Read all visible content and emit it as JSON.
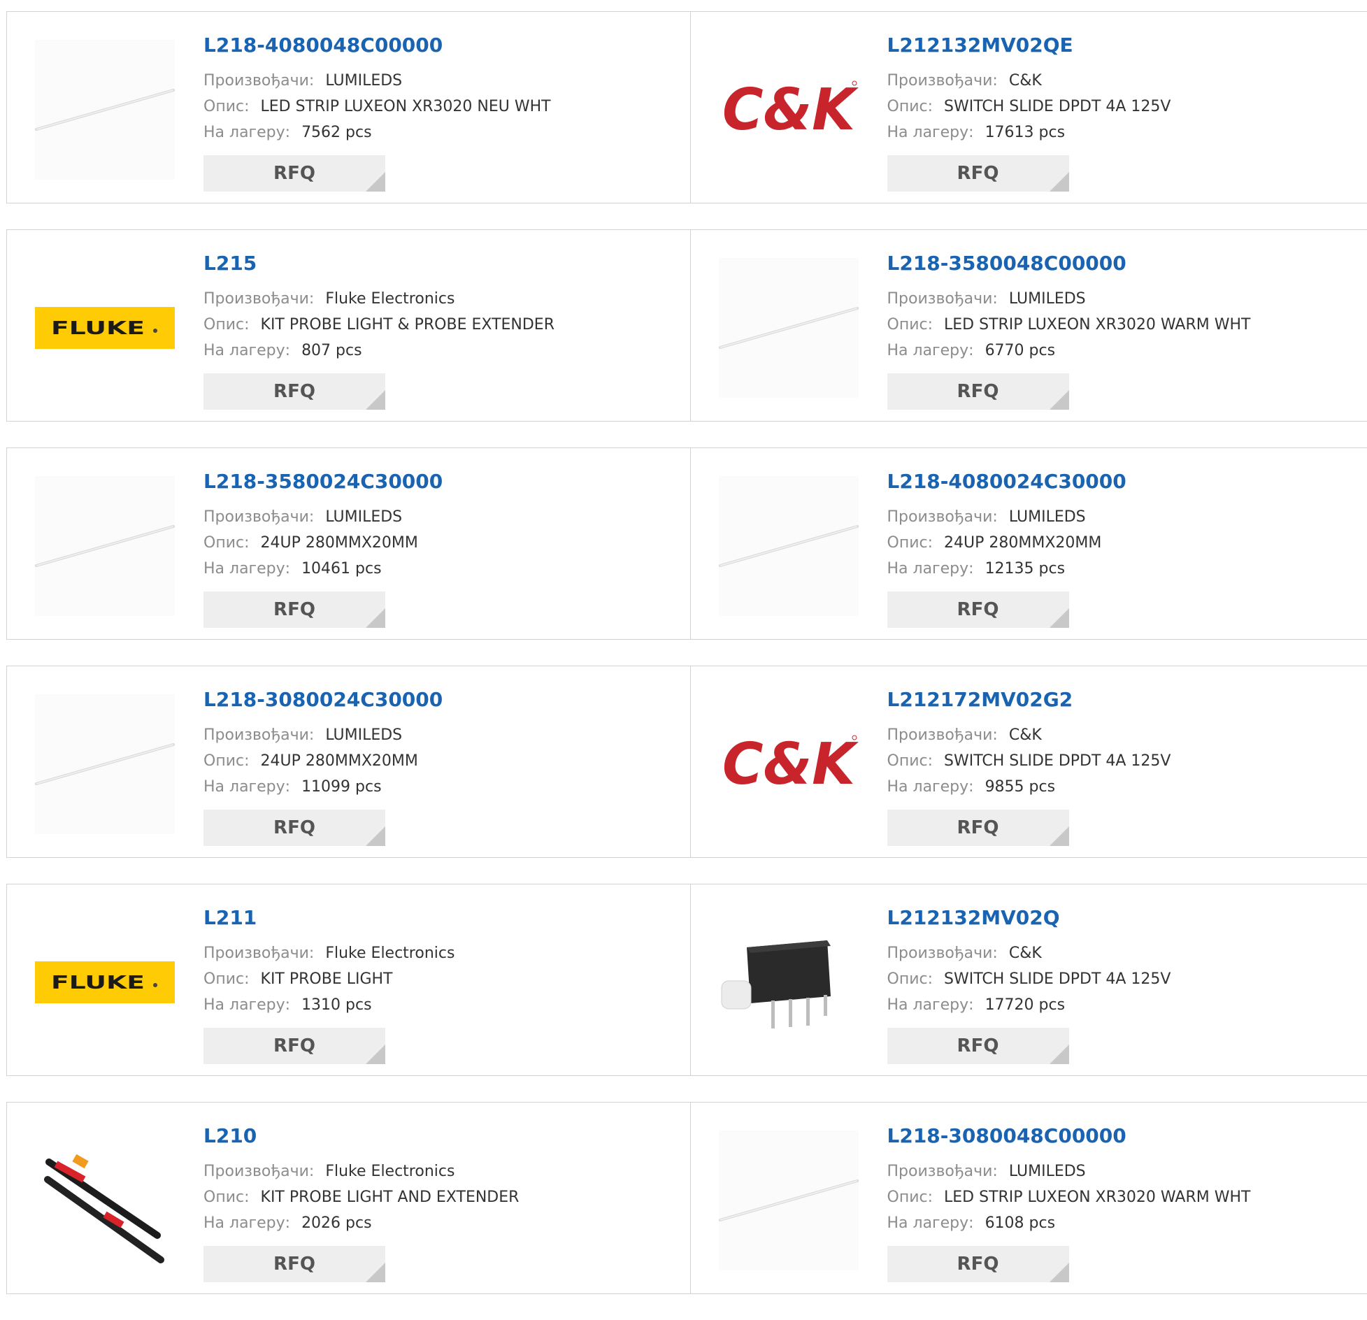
{
  "labels": {
    "manufacturer": "Произвођачи:",
    "description": "Опис:",
    "stock": "На лагеру:",
    "rfq": "RFQ"
  },
  "logos": {
    "ck_text": "C&K",
    "fluke_text": "FLUKE"
  },
  "colors": {
    "part_link": "#1a63b0",
    "ck_red": "#c8242c",
    "fluke_yellow": "#ffcb05"
  },
  "products": [
    {
      "pn": "L218-4080048C00000",
      "mfr": "LUMILEDS",
      "desc": "LED STRIP LUXEON XR3020 NEU WHT",
      "stock": "7562 pcs",
      "image": "led-strip"
    },
    {
      "pn": "L212132MV02QE",
      "mfr": "C&K",
      "desc": "SWITCH SLIDE DPDT 4A 125V",
      "stock": "17613 pcs",
      "image": "ck-logo"
    },
    {
      "pn": "L215",
      "mfr": "Fluke Electronics",
      "desc": "KIT PROBE LIGHT & PROBE EXTENDER",
      "stock": "807 pcs",
      "image": "fluke-logo"
    },
    {
      "pn": "L218-3580048C00000",
      "mfr": "LUMILEDS",
      "desc": "LED STRIP LUXEON XR3020 WARM WHT",
      "stock": "6770 pcs",
      "image": "led-strip"
    },
    {
      "pn": "L218-3580024C30000",
      "mfr": "LUMILEDS",
      "desc": "24UP 280MMX20MM",
      "stock": "10461 pcs",
      "image": "led-strip"
    },
    {
      "pn": "L218-4080024C30000",
      "mfr": "LUMILEDS",
      "desc": "24UP 280MMX20MM",
      "stock": "12135 pcs",
      "image": "led-strip"
    },
    {
      "pn": "L218-3080024C30000",
      "mfr": "LUMILEDS",
      "desc": "24UP 280MMX20MM",
      "stock": "11099 pcs",
      "image": "led-strip"
    },
    {
      "pn": "L212172MV02G2",
      "mfr": "C&K",
      "desc": "SWITCH SLIDE DPDT 4A 125V",
      "stock": "9855 pcs",
      "image": "ck-logo"
    },
    {
      "pn": "L211",
      "mfr": "Fluke Electronics",
      "desc": "KIT PROBE LIGHT",
      "stock": "1310 pcs",
      "image": "fluke-logo"
    },
    {
      "pn": "L212132MV02Q",
      "mfr": "C&K",
      "desc": "SWITCH SLIDE DPDT 4A 125V",
      "stock": "17720 pcs",
      "image": "switch-photo"
    },
    {
      "pn": "L210",
      "mfr": "Fluke Electronics",
      "desc": "KIT PROBE LIGHT AND EXTENDER",
      "stock": "2026 pcs",
      "image": "probe-photo"
    },
    {
      "pn": "L218-3080048C00000",
      "mfr": "LUMILEDS",
      "desc": "LED STRIP LUXEON XR3020 WARM WHT",
      "stock": "6108 pcs",
      "image": "led-strip"
    }
  ]
}
